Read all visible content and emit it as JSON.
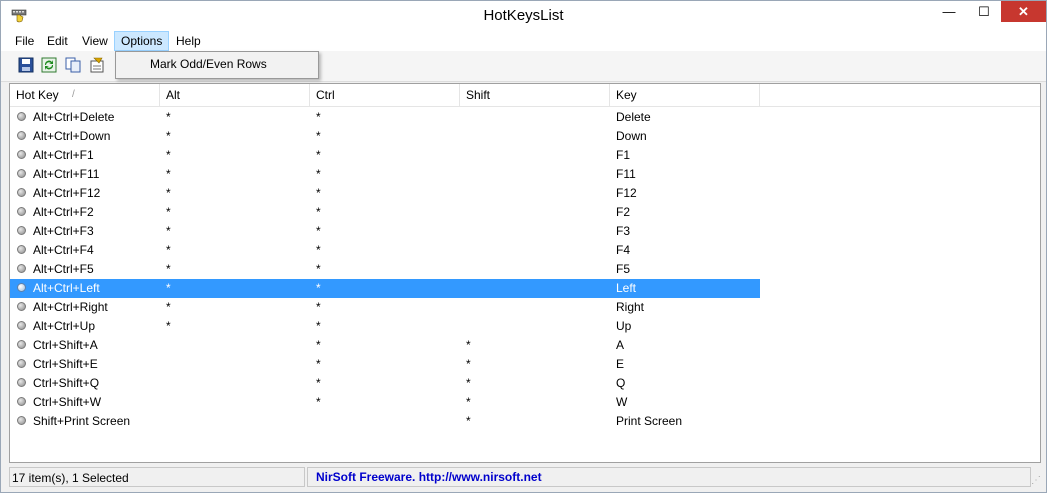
{
  "window": {
    "title": "HotKeysList",
    "minimize_glyph": "—",
    "maximize_glyph": "☐",
    "close_glyph": "✕"
  },
  "menu": {
    "items": [
      "File",
      "Edit",
      "View",
      "Options",
      "Help"
    ],
    "active": "Options"
  },
  "options_menu": {
    "items": [
      "Mark Odd/Even Rows"
    ]
  },
  "toolbar": {
    "buttons": [
      "save-icon",
      "refresh-icon",
      "copy-icon",
      "properties-icon"
    ]
  },
  "table": {
    "columns": [
      "Hot Key",
      "Alt",
      "Ctrl",
      "Shift",
      "Key"
    ],
    "sorted_column": "Hot Key",
    "sort_glyph": "/",
    "rows": [
      [
        "Alt+Ctrl+Delete",
        "*",
        "*",
        "",
        "Delete"
      ],
      [
        "Alt+Ctrl+Down",
        "*",
        "*",
        "",
        "Down"
      ],
      [
        "Alt+Ctrl+F1",
        "*",
        "*",
        "",
        "F1"
      ],
      [
        "Alt+Ctrl+F11",
        "*",
        "*",
        "",
        "F11"
      ],
      [
        "Alt+Ctrl+F12",
        "*",
        "*",
        "",
        "F12"
      ],
      [
        "Alt+Ctrl+F2",
        "*",
        "*",
        "",
        "F2"
      ],
      [
        "Alt+Ctrl+F3",
        "*",
        "*",
        "",
        "F3"
      ],
      [
        "Alt+Ctrl+F4",
        "*",
        "*",
        "",
        "F4"
      ],
      [
        "Alt+Ctrl+F5",
        "*",
        "*",
        "",
        "F5"
      ],
      [
        "Alt+Ctrl+Left",
        "*",
        "*",
        "",
        "Left"
      ],
      [
        "Alt+Ctrl+Right",
        "*",
        "*",
        "",
        "Right"
      ],
      [
        "Alt+Ctrl+Up",
        "*",
        "*",
        "",
        "Up"
      ],
      [
        "Ctrl+Shift+A",
        "",
        "*",
        "*",
        "A"
      ],
      [
        "Ctrl+Shift+E",
        "",
        "*",
        "*",
        "E"
      ],
      [
        "Ctrl+Shift+Q",
        "",
        "*",
        "*",
        "Q"
      ],
      [
        "Ctrl+Shift+W",
        "",
        "*",
        "*",
        "W"
      ],
      [
        "Shift+Print Screen",
        "",
        "",
        "*",
        "Print Screen"
      ]
    ],
    "selected_index": 9
  },
  "status": {
    "left": "17 item(s), 1 Selected",
    "right": "NirSoft Freeware.  http://www.nirsoft.net"
  },
  "colors": {
    "selection": "#3399ff",
    "link": "#0000cc",
    "close_button": "#c7372f"
  }
}
